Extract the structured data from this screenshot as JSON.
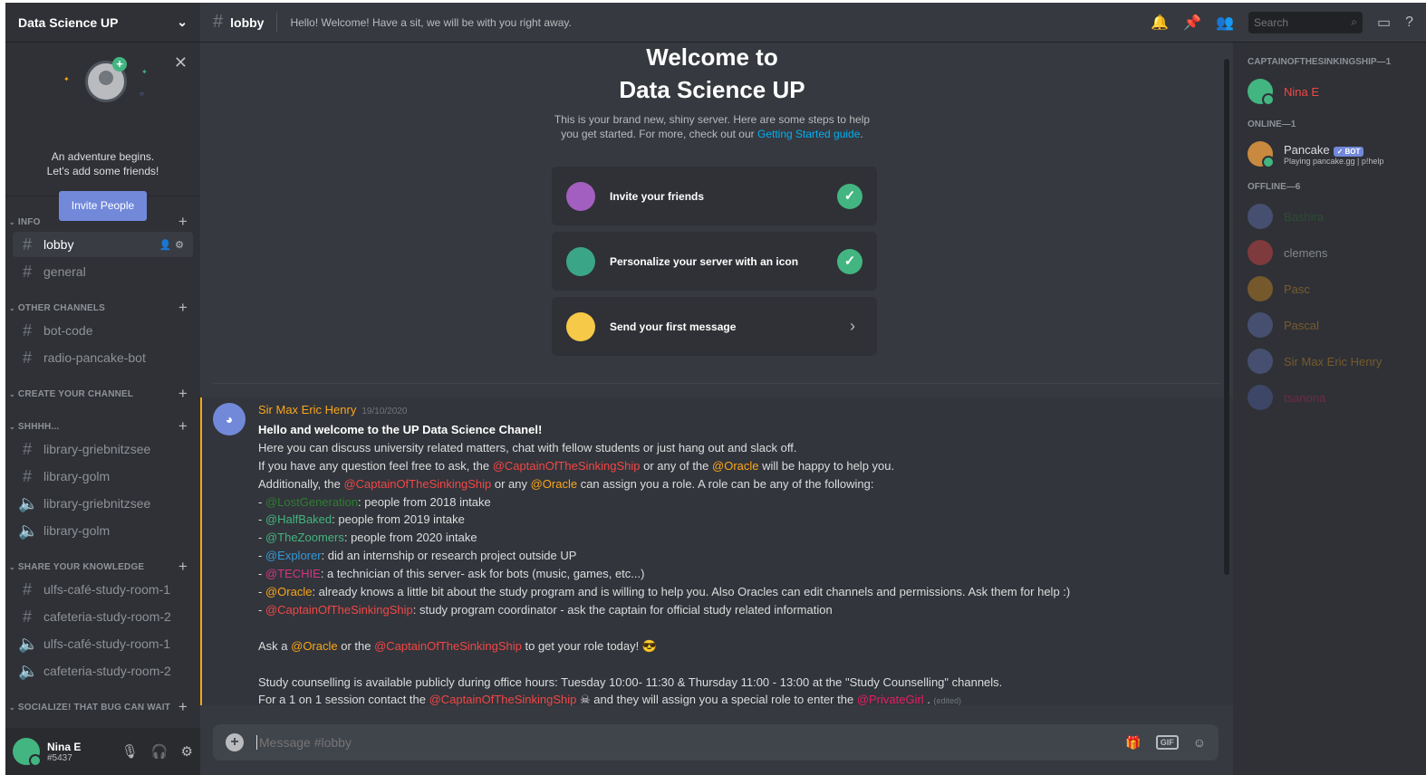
{
  "server": {
    "name": "Data Science UP"
  },
  "sidebar_welcome": {
    "line1": "An adventure begins.",
    "line2": "Let's add some friends!",
    "invite_label": "Invite People"
  },
  "categories": {
    "info": "INFO",
    "other": "OTHER CHANNELS",
    "create": "CREATE YOUR CHANNEL",
    "shhh": "SHHHH...",
    "share": "SHARE YOUR KNOWLEDGE",
    "social": "SOCIALIZE! THAT BUG CAN WAIT"
  },
  "channels": {
    "lobby": "lobby",
    "general": "general",
    "bot_code": "bot-code",
    "radio": "radio-pancake-bot",
    "lib_grieb_text": "library-griebnitzsee",
    "lib_golm_text": "library-golm",
    "lib_grieb_voice": "library-griebnitzsee",
    "lib_golm_voice": "library-golm",
    "ulfs_text": "ulfs-café-study-room-1",
    "cafeteria_text": "cafeteria-study-room-2",
    "ulfs_voice": "ulfs-café-study-room-1",
    "cafeteria_voice": "cafeteria-study-room-2"
  },
  "user": {
    "name": "Nina E",
    "discriminator": "#5437"
  },
  "topbar": {
    "channel": "lobby",
    "topic": "Hello! Welcome! Have a sit, we will be with you right away.",
    "search_placeholder": "Search"
  },
  "welcome": {
    "title1": "Welcome to",
    "title2": "Data Science UP",
    "desc1": "This is your brand new, shiny server. Here are some steps to help",
    "desc2a": "you get started. For more, check out our ",
    "desc2_link": "Getting Started guide",
    "desc2b": "."
  },
  "tasks": [
    {
      "label": "Invite your friends",
      "done": true
    },
    {
      "label": "Personalize your server with an icon",
      "done": true
    },
    {
      "label": "Send your first message",
      "done": false
    }
  ],
  "message": {
    "author": "Sir Max Eric Henry",
    "date": "19/10/2020",
    "heading": "Hello and welcome to the UP Data Science Chanel!",
    "l1": "Here you can discuss university related matters, chat with fellow students or just hang out and slack off.",
    "l2a": "If you have any question feel free to ask, the ",
    "l2b": " or any of the ",
    "l2c": "  will be happy to help you.",
    "l3a": "Additionally, the ",
    "l3b": " or any ",
    "l3c": " can assign you a role. A role can be any of the following:",
    "mention_captain": "@CaptainOfTheSinkingShip",
    "mention_oracle": "@Oracle",
    "mention_lost": "@LostGeneration",
    "mention_half": "@HalfBaked",
    "mention_zoom": "@TheZoomers",
    "mention_expl": "@Explorer",
    "mention_techie": "@TECHIE",
    "mention_private": "@PrivateGirl",
    "dash": "- ",
    "r1": ": people from 2018 intake",
    "r2": ": people from 2019 intake",
    "r3": ": people from 2020 intake",
    "r4": ": did an internship or research project outside UP",
    "r5": ": a technician of this server- ask for bots (music, games, etc...)",
    "r6": ": already knows a little bit about the study program and is willing to help you. Also Oracles can edit channels and permissions. Ask them for help :)",
    "r7": ": study program coordinator - ask the captain for official study related information",
    "ask_a": "Ask a ",
    "ask_b": " or the ",
    "ask_c": " to get your role today!",
    "study1": "Study counselling is available publicly during office hours: Tuesday 10:00- 11:30 & Thursday 11:00 - 13:00 at the \"Study Counselling\" channels.",
    "study2a": "For a 1 on 1 session contact the ",
    "study2b": "  and they will assign you a special role to enter the ",
    "study2c": " . ",
    "edited": "(edited)"
  },
  "composer": {
    "placeholder": "Message #lobby"
  },
  "members": {
    "cat_captain": "CAPTAINOFTHESINKINGSHIP—1",
    "cat_online": "ONLINE—1",
    "cat_offline": "OFFLINE—6",
    "captain": "Nina E",
    "pancake": "Pancake",
    "bot_tag": "✓ BOT",
    "pancake_activity": "Playing pancake.gg | p!help",
    "offline": [
      "Bashira",
      "clemens",
      "Pasc",
      "Pascal",
      "Sir Max Eric Henry",
      "tsanona"
    ]
  },
  "colors": {
    "accent": "#7289da",
    "online": "#43b581",
    "mention_red": "#f04747",
    "mention_orange": "#faa61a"
  }
}
